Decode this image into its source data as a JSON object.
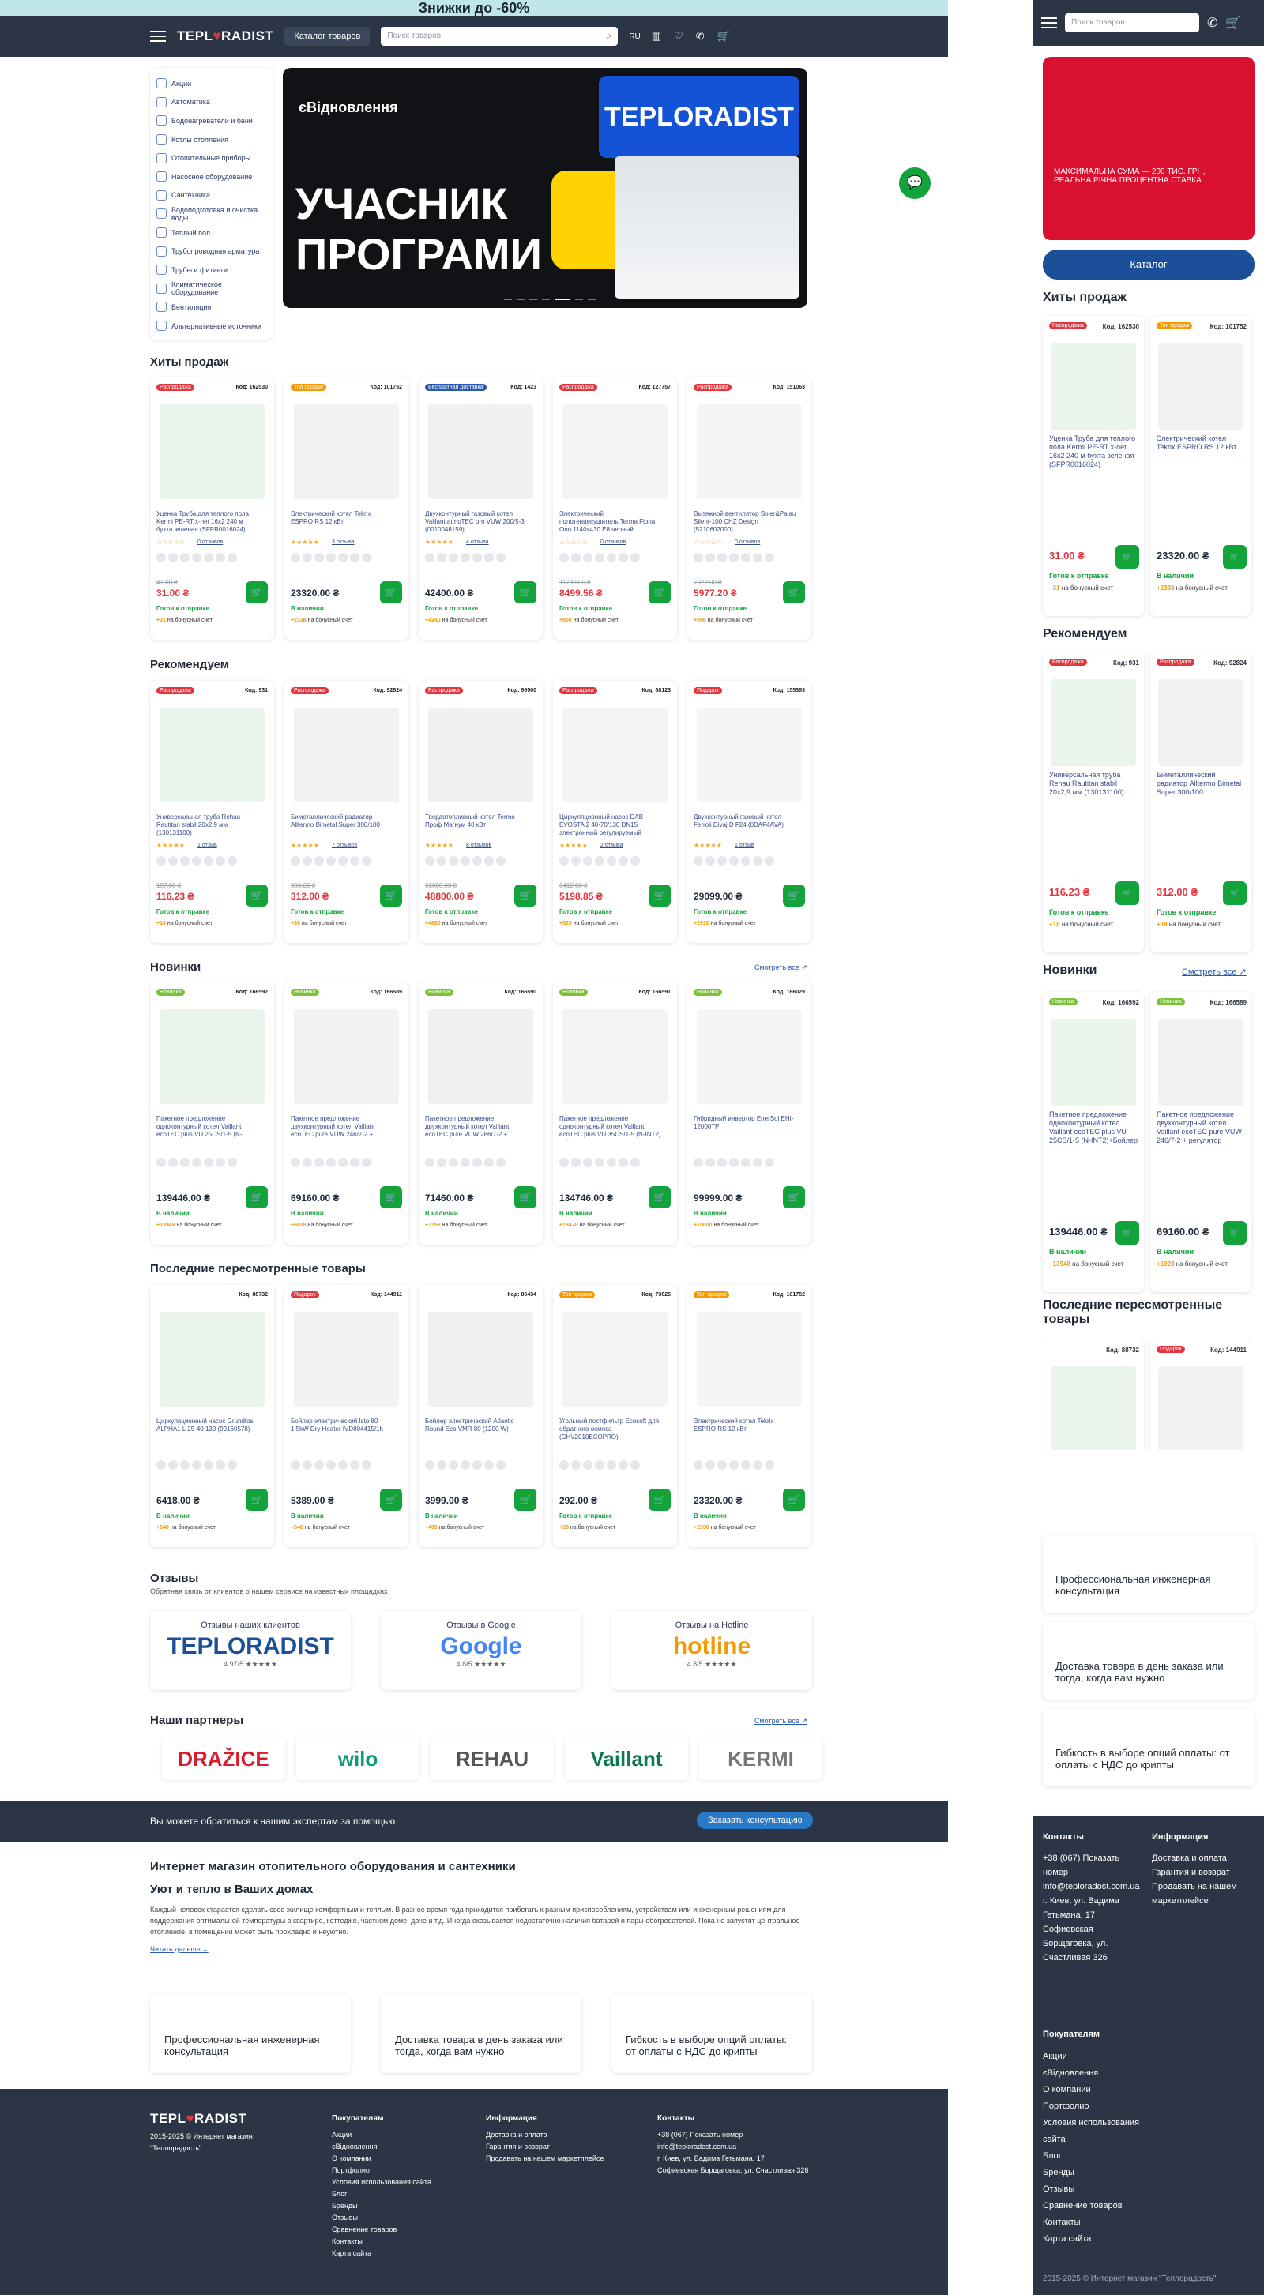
{
  "promo": "Знижки до -60%",
  "header": {
    "logo_a": "TEPL",
    "logo_b": "♥",
    "logo_c": "RADIST",
    "catalog": "Каталог товаров",
    "search_placeholder": "Поиск товаров",
    "lang": "RU"
  },
  "sidebar": [
    "Акции",
    "Автоматика",
    "Водонагреватели и бани",
    "Котлы отопления",
    "Отопительные приборы",
    "Насосное оборудование",
    "Сантехника",
    "Водоподготовка и очистка воды",
    "Теплый пол",
    "Трубопроводная арматура",
    "Трубы и фитинги",
    "Климатическое оборудование",
    "Вентиляция",
    "Альтернативные источники"
  ],
  "banner": {
    "top": "єВідновлення",
    "big1": "УЧАСНИК",
    "big2": "ПРОГРАМИ",
    "logo": "TEPLORADIST"
  },
  "sections": {
    "hits": "Хиты продаж",
    "recommend": "Рекомендуем",
    "new": "Новинки",
    "viewed": "Последние пересмотренные товары",
    "reviews": "Отзывы",
    "reviews_sub": "Обратная связь от клиентов о нашем сервисе на известных площадках",
    "partners": "Наши партнеры",
    "see_all": "Смотреть все ↗"
  },
  "hits": [
    {
      "tag": "Распродажа",
      "code": "Код: 162530",
      "name": "Уценка Труба для теплого пола Kermi PE-RT x-net 16x2 240 м бухта зеленая (SFPR0016024)",
      "old": "41.00 ₴",
      "price": "31.00 ₴",
      "avail": "Готов к отправке",
      "bonus": "+31",
      "stars": "☆☆☆☆☆",
      "rev": "0 отзывов"
    },
    {
      "tag": "Топ продаж",
      "code": "Код: 101752",
      "name": "Электрический котел Tekrix ESPRO RS 12 кВт",
      "old": "",
      "price": "23320.00 ₴",
      "avail": "В наличии",
      "bonus": "+2338",
      "stars": "★★★★★",
      "rev": "3 отзыва"
    },
    {
      "tag": "Бесплатная доставка",
      "code": "Код: 1423",
      "name": "Двухконтурный газовый котел Vaillant atmoTEC pro VUW 200/5-3 (0010048159)",
      "old": "",
      "price": "42400.00 ₴",
      "avail": "Готов к отправке",
      "bonus": "+4240",
      "stars": "★★★★★",
      "rev": "4 отзыва"
    },
    {
      "tag": "Распродажа",
      "code": "Код: 127757",
      "name": "Электрический полотенцесушитель Terma Fiona Ono 1140x430 E8 черный",
      "old": "11730.00 ₴",
      "price": "8499.56 ₴",
      "avail": "Готов к отправке",
      "bonus": "+850",
      "stars": "☆☆☆☆☆",
      "rev": "0 отзывов"
    },
    {
      "tag": "Распродажа",
      "code": "Код: 151063",
      "name": "Вытяжной вентилятор Soler&Palau Silent-100 CHZ Design (5210602000)",
      "old": "7922.00 ₴",
      "price": "5977.20 ₴",
      "avail": "Готов к отправке",
      "bonus": "+598",
      "stars": "☆☆☆☆☆",
      "rev": "0 отзывов"
    }
  ],
  "recommend": [
    {
      "tag": "Распродажа",
      "code": "Код: 931",
      "name": "Универсальная труба Rehau Rautitan stabil 20x2,9 мм (130131100)",
      "old": "197.00 ₴",
      "price": "116.23 ₴",
      "avail": "Готов к отправке",
      "bonus": "+18",
      "stars": "★★★★★",
      "rev": "1 отзыв"
    },
    {
      "tag": "Распродажа",
      "code": "Код: 92824",
      "name": "Биметаллический радиатор Alltermo Bimetal Super 300/100",
      "old": "390.00 ₴",
      "price": "312.00 ₴",
      "avail": "Готов к отправке",
      "bonus": "+38",
      "stars": "★★★★★",
      "rev": "7 отзывов"
    },
    {
      "tag": "Распродажа",
      "code": "Код: 99500",
      "name": "Твердотопливный котел Termo Проф Магнум 40 кВт",
      "old": "61000.00 ₴",
      "price": "48800.00 ₴",
      "avail": "Готов к отправке",
      "bonus": "+4880",
      "stars": "★★★★★",
      "rev": "8 отзывов"
    },
    {
      "tag": "Распродажа",
      "code": "Код: 88123",
      "name": "Циркуляционный насос DAB EVOSTA 2 40-70/130 DN15 электронный регулируемый",
      "old": "6412.00 ₴",
      "price": "5198.85 ₴",
      "avail": "Готов к отправке",
      "bonus": "+520",
      "stars": "★★★★★",
      "rev": "2 отзыва"
    },
    {
      "tag": "Подарок",
      "code": "Код: 155393",
      "name": "Двухконтурный газовый котел Ferroli Divaj D F24 (0DAF4AVA)",
      "old": "",
      "price": "29099.00 ₴",
      "avail": "Готов к отправке",
      "bonus": "+2910",
      "stars": "★★★★★",
      "rev": "1 отзыв"
    }
  ],
  "new": [
    {
      "tag": "Новинка",
      "code": "Код: 166592",
      "name": "Пакетное предложение одноконтурный котел Vaillant ecoTEC plus VU 25CS/1-5 (N-INT2)+Бойлер Vaillant uniSTOR VIH R 120/6 B",
      "price": "139446.00 ₴",
      "avail": "В наличии",
      "bonus": "+13948"
    },
    {
      "tag": "Новинка",
      "code": "Код: 166589",
      "name": "Пакетное предложение двухконтурный котел Vaillant ecoTEC pure VUW 246/7-2 + регулятор",
      "price": "69160.00 ₴",
      "avail": "В наличии",
      "bonus": "+6928"
    },
    {
      "tag": "Новинка",
      "code": "Код: 166590",
      "name": "Пакетное предложение двухконтурный котел Vaillant ecoTEC pure VUW 286/7-2 + регулятор",
      "price": "71460.00 ₴",
      "avail": "В наличии",
      "bonus": "+7158"
    },
    {
      "tag": "Новинка",
      "code": "Код: 166591",
      "name": "Пакетное предложение одноконтурный котел Vaillant ecoTEC plus VU 35CS/1-5 (N-INT2) + бойлер",
      "price": "134746.00 ₴",
      "avail": "В наличии",
      "bonus": "+13478"
    },
    {
      "tag": "Новинка",
      "code": "Код: 166029",
      "name": "Гибридный инвертор EnerSol EHI-12000TP",
      "price": "99999.00 ₴",
      "avail": "В наличии",
      "bonus": "+10000"
    }
  ],
  "viewed": [
    {
      "tag": "",
      "code": "Код: 88732",
      "name": "Циркуляционный насос Grundfos ALPHA1 L 25-40 130 (99160578)",
      "price": "6418.00 ₴",
      "avail": "В наличии",
      "bonus": "+648"
    },
    {
      "tag": "Подарок",
      "code": "Код: 144911",
      "name": "Бойлер электрический Isto 80 1.5kW Dry Heater IVD804415/1h",
      "price": "5389.00 ₴",
      "avail": "В наличии",
      "bonus": "+548"
    },
    {
      "tag": "",
      "code": "Код: 86434",
      "name": "Бойлер электрический Atlantic Round Eco VMR 80 (1200 W)",
      "price": "3999.00 ₴",
      "avail": "В наличии",
      "bonus": "+408"
    },
    {
      "tag": "Топ продаж",
      "code": "Код: 73626",
      "name": "Угольный постфильтр Ecosoft для обратного осмоса (CHV2010ECOPRO)",
      "price": "292.00 ₴",
      "avail": "Готов к отправке",
      "bonus": "+38"
    },
    {
      "tag": "Топ продаж",
      "code": "Код: 101752",
      "name": "Электрический котел Tekrix ESPRO RS 12 кВт",
      "price": "23320.00 ₴",
      "avail": "В наличии",
      "bonus": "+2338"
    }
  ],
  "bonus_label": "на бонусный счет",
  "reviews": [
    {
      "title": "Отзывы наших клиентов",
      "brand": "TEPLORADIST",
      "score": "4.97/5 ★★★★★"
    },
    {
      "title": "Отзывы в Google",
      "brand": "Google",
      "score": "4.8/5 ★★★★★"
    },
    {
      "title": "Отзывы на Hotline",
      "brand": "hotline",
      "score": "4.8/5 ★★★★★"
    }
  ],
  "partners": [
    "DRAŽICE",
    "wilo",
    "REHAU",
    "Vaillant",
    "KERMI"
  ],
  "band": {
    "text": "Вы можете обратиться к нашим экспертам за помощью",
    "btn": "Заказать консультацию"
  },
  "about": {
    "h1": "Интернет магазин отопительного оборудования и сантехники",
    "h2": "Уют и тепло в Ваших домах",
    "p": "Каждый человек старается сделать свое жилище комфортным и теплым. В разное время года приходится прибегать к разным приспособлениям, устройствам или инженерным решениям для поддержания оптимальной температуры в квартире, коттедже, частном доме, даче и т.д. Иногда оказывается недостаточно наличия батарей и пары обогревателей. Пока не запустят центральное отопление, в помещении может быть прохладно и неуютно.",
    "more": "Читать дальше ⌄"
  },
  "features": [
    "Профессиональная инженерная консультация",
    "Доставка товара в день заказа или тогда, когда вам нужно",
    "Гибкость в выборе опций оплаты: от оплаты с НДС до крипты"
  ],
  "footer": {
    "copy": "2015-2025 © Интернет магазин \"Теплорадость\"",
    "buyers": "Покупателям",
    "buyers_items": [
      "Акции",
      "єВідновлення",
      "О компании",
      "Портфолио",
      "Условия использования сайта",
      "Блог",
      "Бренды",
      "Отзывы",
      "Сравнение товаров",
      "Контакты",
      "Карта сайта"
    ],
    "info": "Информация",
    "info_items": [
      "Доставка и оплата",
      "Гарантия и возврат",
      "Продавать на нашем маркетплейсе"
    ],
    "contacts": "Контакты",
    "contacts_items": [
      "+38 (067) Показать номер",
      "info@teploradost.com.ua",
      "г. Киев, ул. Вадима Гетьмана, 17",
      "Софиевская Борщаговка, ул. Счастливая 326"
    ]
  },
  "mobile": {
    "search_placeholder": "Поиск товаров",
    "catalog": "Каталог",
    "banner_text": "МАКСИМАЛЬНА СУМА — 200 ТИС. ГРН, РЕАЛЬНА РІЧНА ПРОЦЕНТНА СТАВКА",
    "hits": "Хиты продаж",
    "recommend": "Рекомендуем",
    "new": "Новинки",
    "viewed": "Последние пересмотренные товары",
    "see_all": "Смотреть все ↗"
  }
}
